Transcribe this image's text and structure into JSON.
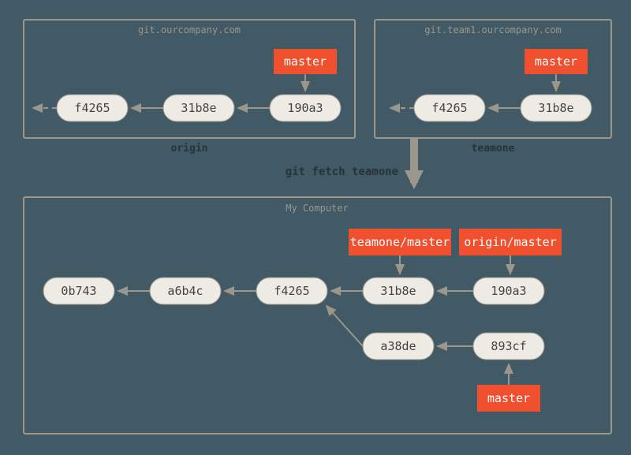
{
  "colors": {
    "bg": "#425a66",
    "accent": "#f1502f",
    "node": "#eeebe4",
    "stroke": "#9b978c"
  },
  "command": "git fetch teamone",
  "remotes": {
    "origin": {
      "url": "git.ourcompany.com",
      "label": "origin",
      "refs": {
        "master": "master"
      },
      "commits": [
        "f4265",
        "31b8e",
        "190a3"
      ]
    },
    "teamone": {
      "url": "git.team1.ourcompany.com",
      "label": "teamone",
      "refs": {
        "master": "master"
      },
      "commits": [
        "f4265",
        "31b8e"
      ]
    }
  },
  "local": {
    "title": "My Computer",
    "refs": {
      "teamone_master": "teamone/master",
      "origin_master": "origin/master",
      "master": "master"
    },
    "commits": [
      "0b743",
      "a6b4c",
      "f4265",
      "31b8e",
      "190a3",
      "a38de",
      "893cf"
    ]
  }
}
